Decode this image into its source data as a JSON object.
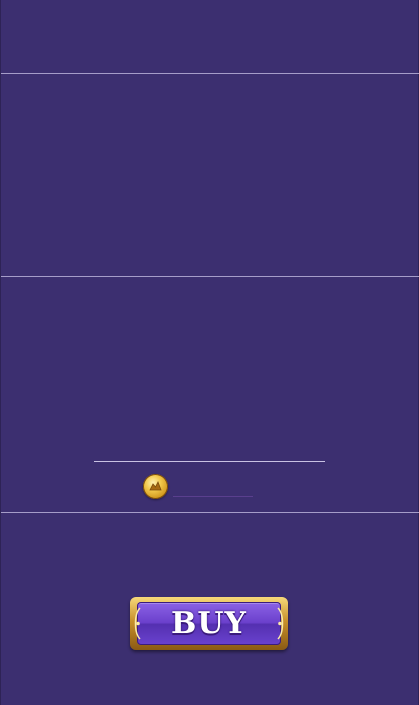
{
  "shop": {
    "item_price": "",
    "buy_label": "BUY"
  },
  "colors": {
    "background": "#3c2f70",
    "divider": "#b9b0d8",
    "button_gold": "#c8912c",
    "button_purple": "#6b40cc"
  },
  "icons": {
    "coin": "gold-coin-icon"
  }
}
